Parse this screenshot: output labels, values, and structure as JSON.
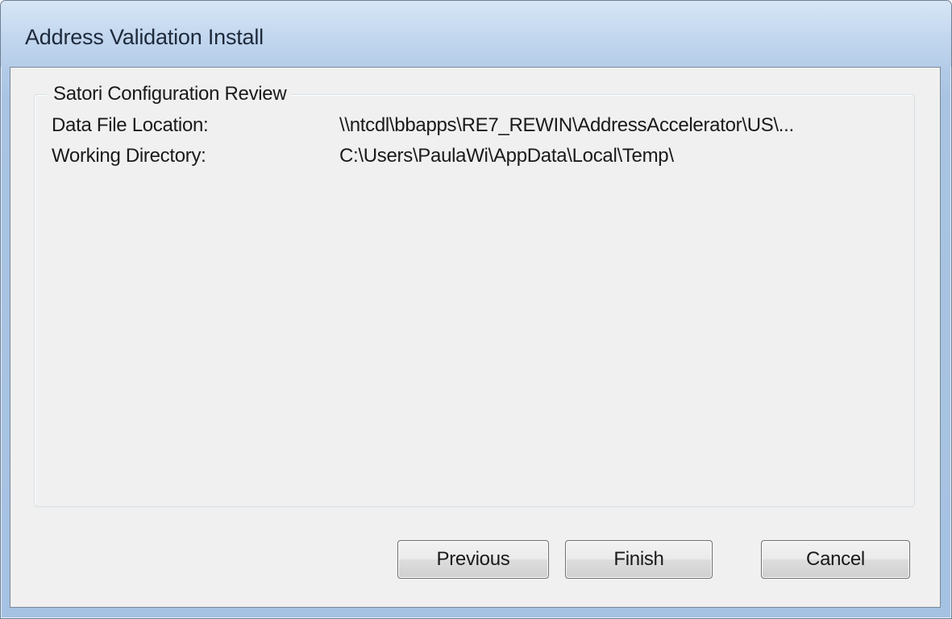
{
  "window": {
    "title": "Address Validation Install"
  },
  "group": {
    "label": "Satori Configuration Review",
    "rows": [
      {
        "label": "Data File Location:",
        "value": "\\\\ntcdl\\bbapps\\RE7_REWIN\\AddressAccelerator\\US\\..."
      },
      {
        "label": "Working Directory:",
        "value": "C:\\Users\\PaulaWi\\AppData\\Local\\Temp\\"
      }
    ]
  },
  "buttons": {
    "previous": "Previous",
    "finish": "Finish",
    "cancel": "Cancel"
  },
  "colors": {
    "titlebar": "#b8d0ea",
    "client_background": "#f0f0f0"
  }
}
